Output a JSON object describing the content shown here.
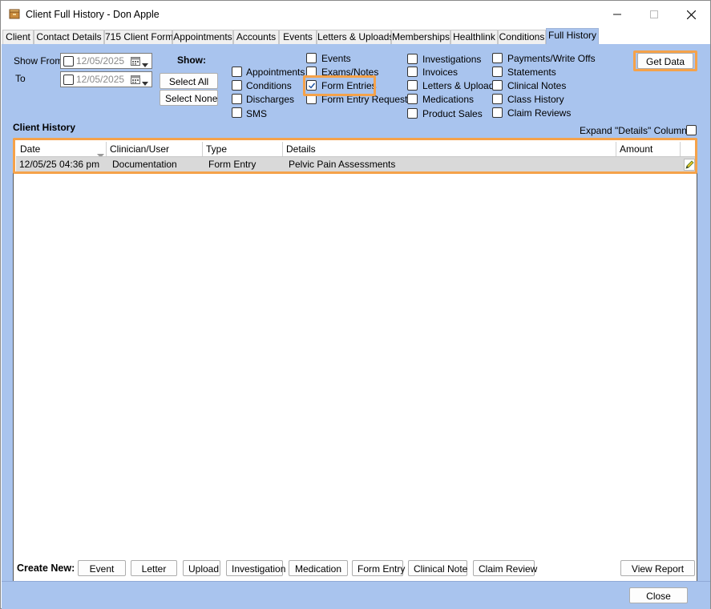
{
  "window": {
    "title": "Client Full History - Don Apple",
    "controls": [
      "minimize",
      "maximize",
      "close"
    ]
  },
  "tabs": [
    {
      "label": "Client"
    },
    {
      "label": "Contact Details"
    },
    {
      "label": "715 Client Form"
    },
    {
      "label": "Appointments"
    },
    {
      "label": "Accounts"
    },
    {
      "label": "Events"
    },
    {
      "label": "Letters & Uploads"
    },
    {
      "label": "Memberships"
    },
    {
      "label": "Healthlink"
    },
    {
      "label": "Conditions"
    },
    {
      "label": "Full History"
    }
  ],
  "active_tab": "Full History",
  "filters": {
    "show_from_label": "Show From",
    "to_label": "To",
    "show_from_value": "12/05/2025",
    "to_value": "12/05/2025",
    "show_label": "Show:",
    "select_all": "Select All",
    "select_none": "Select None",
    "get_data": "Get Data"
  },
  "show_options": [
    {
      "label": "Appointments",
      "checked": false
    },
    {
      "label": "Conditions",
      "checked": false
    },
    {
      "label": "Discharges",
      "checked": false
    },
    {
      "label": "SMS",
      "checked": false
    },
    {
      "label": "Events",
      "checked": false
    },
    {
      "label": "Exams/Notes",
      "checked": false
    },
    {
      "label": "Form Entries",
      "checked": true
    },
    {
      "label": "Form Entry Requests",
      "checked": false
    },
    {
      "label": "Investigations",
      "checked": false
    },
    {
      "label": "Invoices",
      "checked": false
    },
    {
      "label": "Letters & Uploads",
      "checked": false
    },
    {
      "label": "Medications",
      "checked": false
    },
    {
      "label": "Product Sales",
      "checked": false
    },
    {
      "label": "Payments/Write Offs",
      "checked": false
    },
    {
      "label": "Statements",
      "checked": false
    },
    {
      "label": "Clinical Notes",
      "checked": false
    },
    {
      "label": "Class History",
      "checked": false
    },
    {
      "label": "Claim Reviews",
      "checked": false
    }
  ],
  "history": {
    "heading": "Client History",
    "expand_label": "Expand \"Details\" Column?",
    "expand_checked": false,
    "columns": [
      "Date",
      "Clinician/User",
      "Type",
      "Details",
      "Amount"
    ],
    "rows": [
      {
        "date": "12/05/25 04:36 pm",
        "clinician": "Documentation",
        "type": "Form Entry",
        "details": "Pelvic Pain Assessments",
        "amount": ""
      }
    ]
  },
  "create_new": {
    "label": "Create New:",
    "buttons": [
      "Event",
      "Letter",
      "Upload",
      "Investigation",
      "Medication",
      "Form Entry",
      "Clinical Note",
      "Claim Review"
    ],
    "view_report": "View Report"
  },
  "footer": {
    "close": "Close"
  },
  "colors": {
    "panel": "#a9c4ee",
    "highlight": "#f5a24a",
    "selected_row": "#d9d9d9"
  }
}
